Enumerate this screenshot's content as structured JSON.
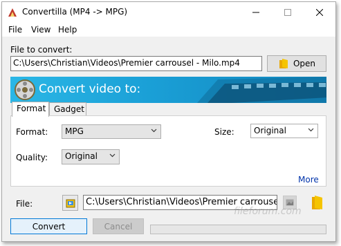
{
  "window": {
    "title": "Convertilla  (MP4 -> MPG)",
    "controls": {
      "minimize": "—",
      "maximize": "☐",
      "close": "✕"
    }
  },
  "menu": [
    "File",
    "View",
    "Help"
  ],
  "file_to_convert": {
    "label": "File to convert:",
    "value": "C:\\Users\\Christian\\Videos\\Premier carrousel - Milo.mp4",
    "open_button": "Open"
  },
  "banner": {
    "title": "Convert video to:"
  },
  "tabs": [
    "Format",
    "Gadget"
  ],
  "format_panel": {
    "format_label": "Format:",
    "format_value": "MPG",
    "size_label": "Size:",
    "size_value": "Original",
    "quality_label": "Quality:",
    "quality_value": "Original",
    "more_link": "More"
  },
  "output": {
    "label": "File:",
    "value": "C:\\Users\\Christian\\Videos\\Premier carrousel"
  },
  "actions": {
    "convert": "Convert",
    "cancel": "Cancel"
  },
  "progress": {
    "fraction": 0
  },
  "watermark": "fileforum.com",
  "colors": {
    "banner": "#1a9fd6",
    "link": "#0033aa",
    "progress": "#06b025"
  }
}
